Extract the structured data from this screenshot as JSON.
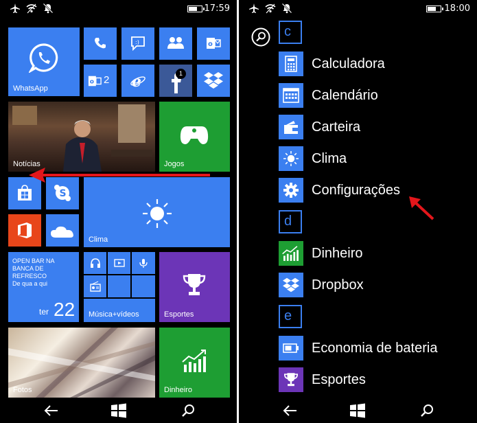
{
  "left_screen": {
    "status": {
      "time": "17:59"
    },
    "tiles": {
      "whatsapp": "WhatsApp",
      "outlook_count": "2",
      "facebook_badge": "1",
      "news": "Notícias",
      "games": "Jogos",
      "weather": "Clima",
      "sports_news_text": "OPEN BAR NA BANCA DE REFRESCO De qua a qui",
      "sports_news_line1": "OPEN BAR NA",
      "sports_news_line2": "BANCA DE REFRESCO",
      "sports_news_line3": "De qua a qui",
      "calendar_weekday": "ter",
      "calendar_day": "22",
      "music": "Música+vídeos",
      "sports": "Esportes",
      "photos": "Fotos",
      "money": "Dinheiro"
    }
  },
  "right_screen": {
    "status": {
      "time": "18:00"
    },
    "sections": [
      {
        "letter": "c",
        "apps": [
          "Calculadora",
          "Calendário",
          "Carteira",
          "Clima",
          "Configurações"
        ]
      },
      {
        "letter": "d",
        "apps": [
          "Dinheiro",
          "Dropbox"
        ]
      },
      {
        "letter": "e",
        "apps": [
          "Economia de bateria",
          "Esportes"
        ]
      }
    ]
  },
  "colors": {
    "accent": "#3b7ff0",
    "green": "#1e9e33",
    "purple": "#6c35b7",
    "office_orange": "#e8461a",
    "annotation_arrow": "#e3161b"
  }
}
